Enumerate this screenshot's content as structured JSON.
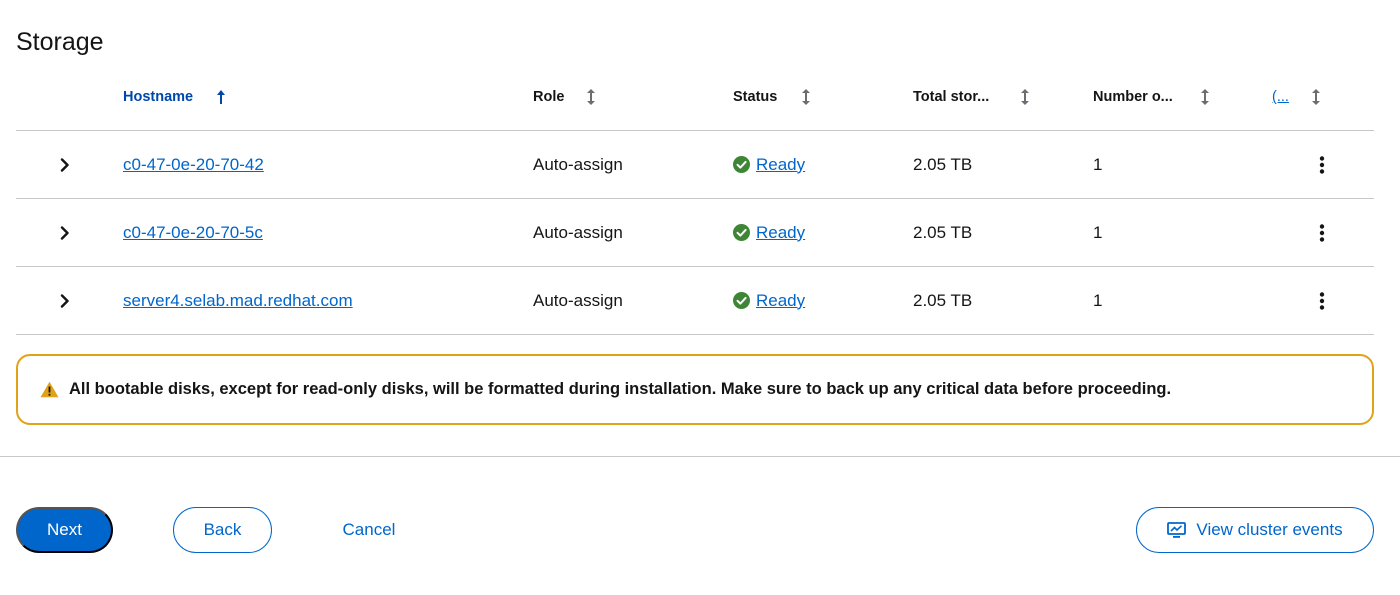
{
  "page": {
    "title": "Storage"
  },
  "table": {
    "headers": {
      "hostname": "Hostname",
      "role": "Role",
      "status": "Status",
      "total_storage": "Total stor...",
      "number_of": "Number o...",
      "extra": "(..."
    },
    "rows": [
      {
        "hostname": "c0-47-0e-20-70-42",
        "role": "Auto-assign",
        "status": "Ready",
        "total": "2.05 TB",
        "number": "1"
      },
      {
        "hostname": "c0-47-0e-20-70-5c",
        "role": "Auto-assign",
        "status": "Ready",
        "total": "2.05 TB",
        "number": "1"
      },
      {
        "hostname": "server4.selab.mad.redhat.com",
        "role": "Auto-assign",
        "status": "Ready",
        "total": "2.05 TB",
        "number": "1"
      }
    ]
  },
  "alert": {
    "text": "All bootable disks, except for read-only disks, will be formatted during installation. Make sure to back up any critical data before proceeding."
  },
  "footer": {
    "next_label": "Next",
    "back_label": "Back",
    "cancel_label": "Cancel",
    "events_label": "View cluster events"
  },
  "colors": {
    "link": "#0066cc",
    "sorted_header": "#0047ab",
    "success": "#3e8635",
    "warning": "#e0a21a",
    "primary_button": "#0066cc"
  },
  "icons": {
    "sort_active": "arrow-up-icon",
    "sort_inactive": "sort-updown-icon",
    "row_toggle": "chevron-right-icon",
    "status": "check-circle-icon",
    "row_actions": "kebab-icon",
    "alert": "warning-triangle-icon",
    "events": "monitor-chart-icon"
  }
}
